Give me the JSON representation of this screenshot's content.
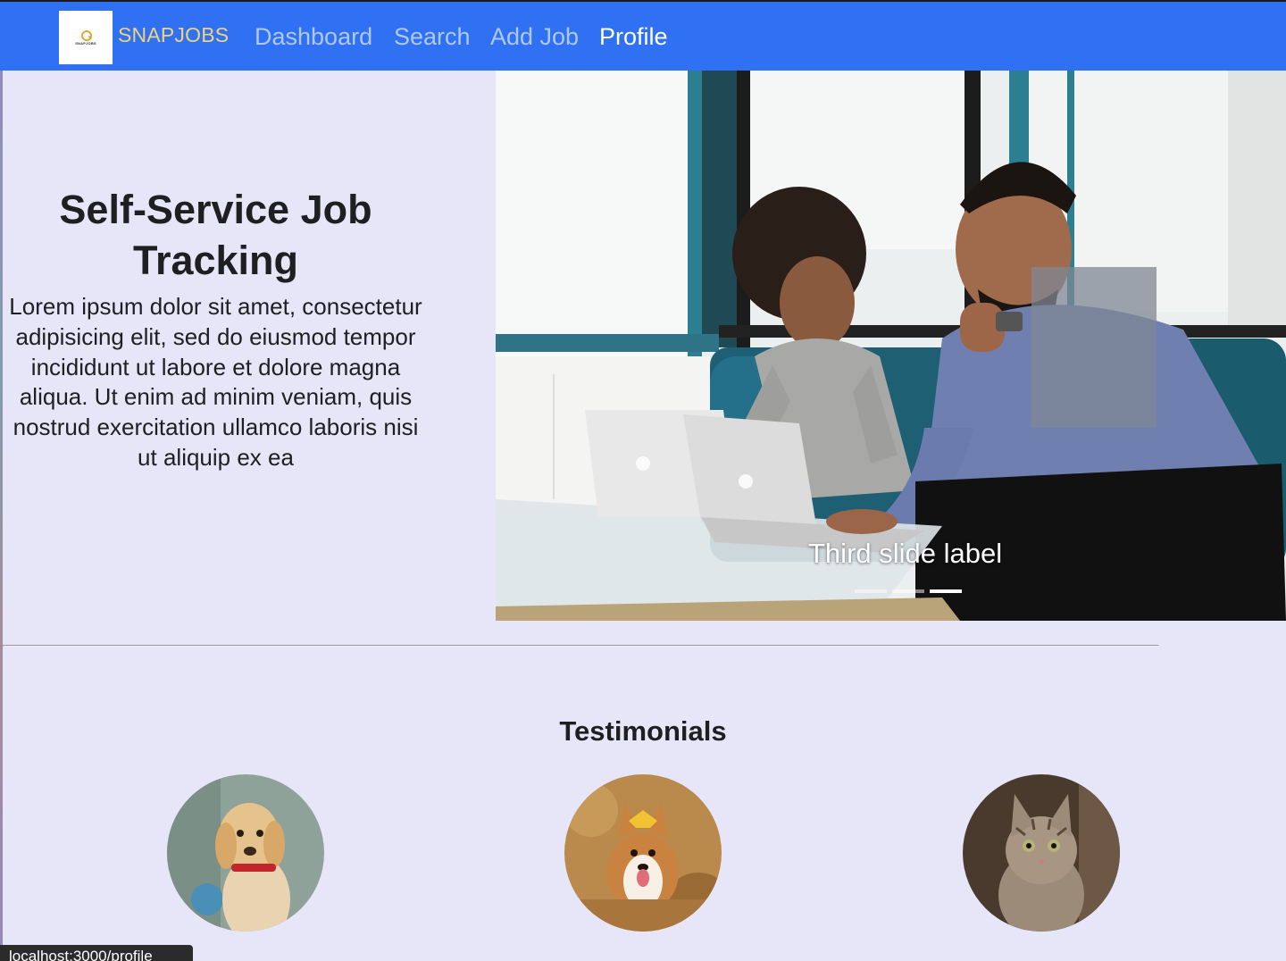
{
  "navbar": {
    "logo_text": "SNAPJOBS",
    "brand_name": "SNAPJOBS",
    "links": [
      {
        "label": "Dashboard",
        "active": false
      },
      {
        "label": "Search",
        "active": false
      },
      {
        "label": "Add Job",
        "active": false
      },
      {
        "label": "Profile",
        "active": true
      }
    ],
    "colors": {
      "background": "#3071f3",
      "brand": "#f1d27a",
      "link": "#aec8f9",
      "active_link": "#ffffff"
    }
  },
  "hero": {
    "title": "Self-Service Job Tracking",
    "body": "Lorem ipsum dolor sit amet, consectetur adipisicing elit, sed do eiusmod tempor incididunt ut labore et dolore magna aliqua. Ut enim ad minim veniam, quis nostrud exercitation ullamco laboris nisi ut aliquip ex ea"
  },
  "carousel": {
    "caption": "Third slide label",
    "slide_count": 3,
    "active_slide": 3,
    "image_icon": "photo-two-people-laptops"
  },
  "testimonials": {
    "title": "Testimonials",
    "avatars": [
      {
        "icon": "puppy-photo-icon"
      },
      {
        "icon": "corgi-photo-icon"
      },
      {
        "icon": "cat-photo-icon"
      }
    ]
  },
  "status_bar": {
    "url": "localhost:3000/profile"
  },
  "colors": {
    "page_background": "#e6e6f8"
  }
}
